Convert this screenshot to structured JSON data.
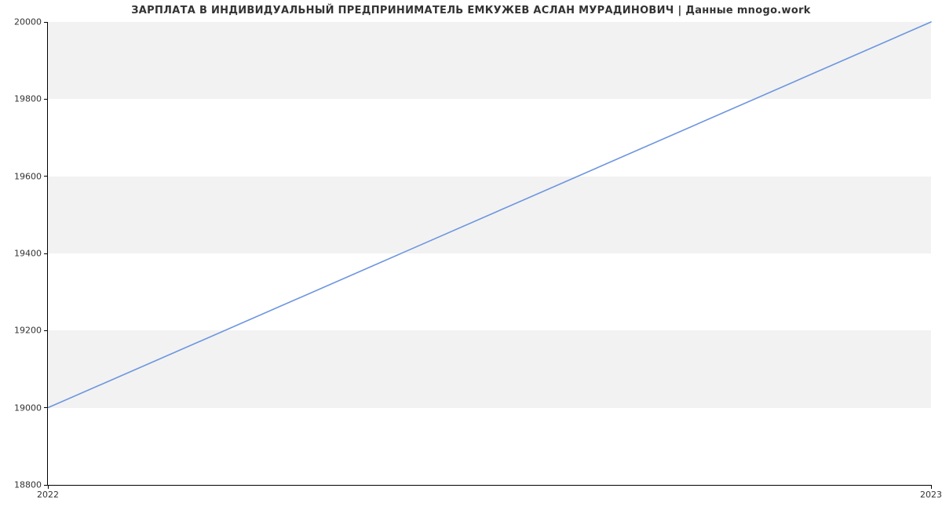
{
  "chart_data": {
    "type": "line",
    "title": "ЗАРПЛАТА В ИНДИВИДУАЛЬНЫЙ ПРЕДПРИНИМАТЕЛЬ ЕМКУЖЕВ АСЛАН МУРАДИНОВИЧ | Данные mnogo.work",
    "x": [
      2022,
      2023
    ],
    "x_labels": [
      "2022",
      "2023"
    ],
    "values": [
      19000,
      20000
    ],
    "xlabel": "",
    "ylabel": "",
    "ylim": [
      18800,
      20000
    ],
    "xlim": [
      2022,
      2023
    ],
    "y_ticks": [
      18800,
      19000,
      19200,
      19400,
      19600,
      19800,
      20000
    ],
    "y_tick_labels": [
      "18800",
      "19000",
      "19200",
      "19400",
      "19600",
      "19800",
      "20000"
    ],
    "line_color": "#6c95e0",
    "band_color": "#f2f2f2"
  }
}
